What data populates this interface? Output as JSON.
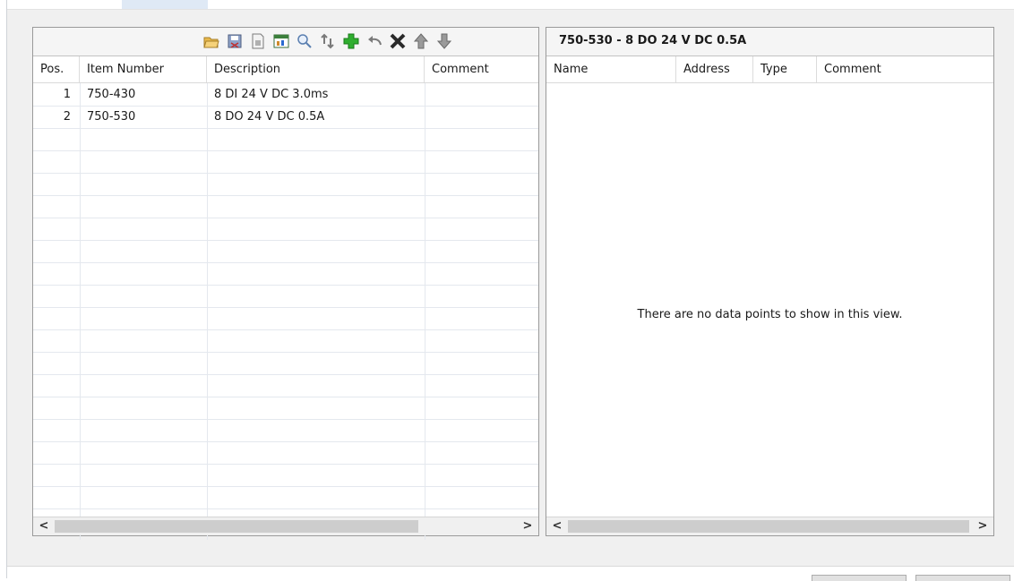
{
  "left_panel": {
    "columns": [
      "Pos.",
      "Item Number",
      "Description",
      "Comment"
    ],
    "rows": [
      {
        "pos": "1",
        "item_number": "750-430",
        "description": "8 DI 24 V DC 3.0ms",
        "comment": ""
      },
      {
        "pos": "2",
        "item_number": "750-530",
        "description": "8 DO 24 V DC 0.5A",
        "comment": ""
      }
    ],
    "toolbar": [
      {
        "name": "open-folder-icon",
        "color": "#e8b84a"
      },
      {
        "name": "save-disk-icon",
        "color": "#6d7fa8"
      },
      {
        "name": "document-icon",
        "color": "#8a8a8a"
      },
      {
        "name": "chart-window-icon",
        "color": "#3c7f3c"
      },
      {
        "name": "search-icon",
        "color": "#5a7fb0"
      },
      {
        "name": "swap-icon",
        "color": "#8a8a8a"
      },
      {
        "name": "add-icon",
        "color": "#2fae2f"
      },
      {
        "name": "undo-icon",
        "color": "#8a8a8a"
      },
      {
        "name": "delete-icon",
        "color": "#2a2a2a"
      },
      {
        "name": "arrow-up-icon",
        "color": "#8a8a8a"
      },
      {
        "name": "arrow-down-icon",
        "color": "#8a8a8a"
      }
    ],
    "scroll_left": "<",
    "scroll_right": ">"
  },
  "right_panel": {
    "title": "750-530 - 8 DO 24 V DC 0.5A",
    "columns": [
      "Name",
      "Address",
      "Type",
      "Comment"
    ],
    "empty_message": "There are no data points to show in this view.",
    "scroll_left": "<",
    "scroll_right": ">"
  }
}
